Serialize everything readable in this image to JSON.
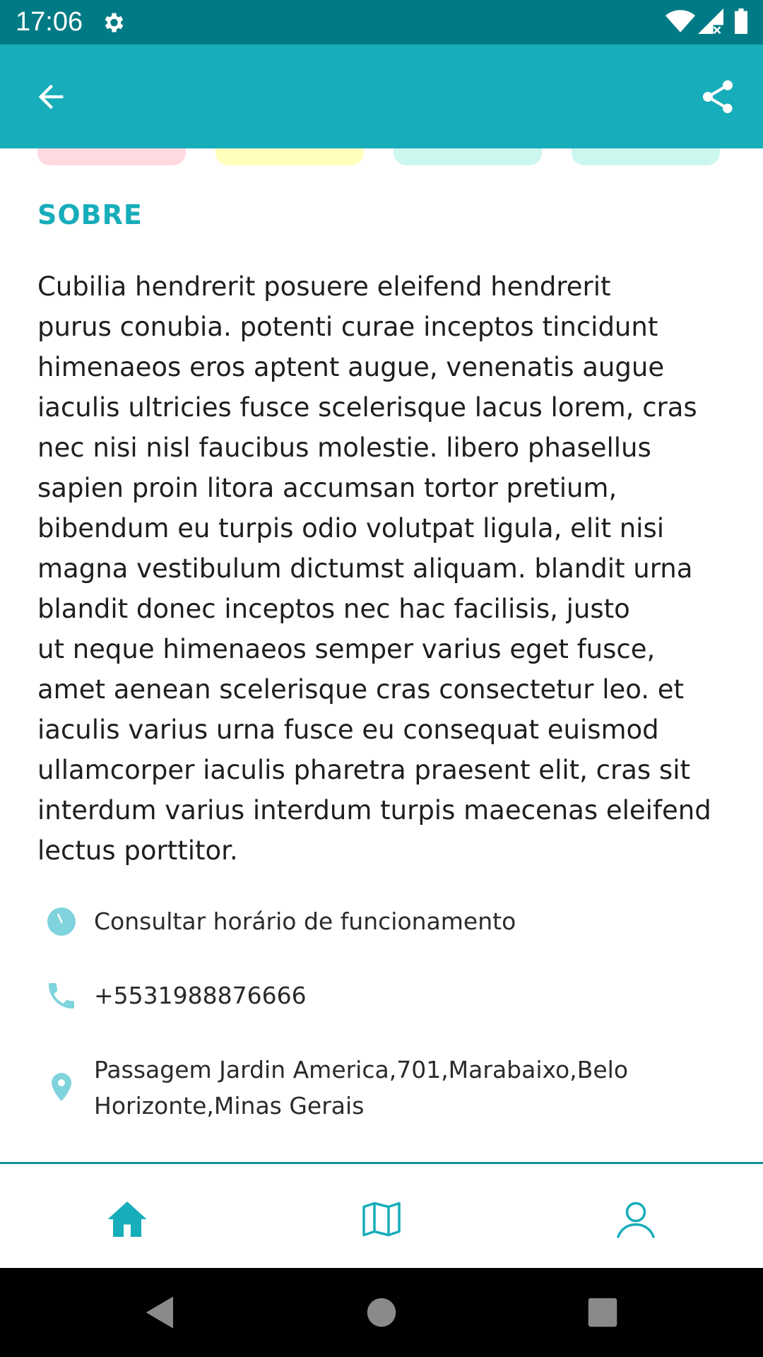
{
  "status_bar": {
    "time": "17:06",
    "left_icon": "gear-icon",
    "right_icons": [
      "wifi-icon",
      "signal-icon",
      "battery-icon"
    ],
    "background": "#007b85"
  },
  "app_bar": {
    "background": "#17adba",
    "back_icon": "arrow-back-icon",
    "share_icon": "share-icon"
  },
  "chips": {
    "colors": [
      "#ffd9e0",
      "#ffffbd",
      "#ccf7ef",
      "#ccf7ef"
    ]
  },
  "section": {
    "title": "SOBRE",
    "accent_color": "#17adba"
  },
  "about": {
    "lines": [
      "Cubilia hendrerit posuere eleifend hendrerit",
      "purus conubia. potenti curae inceptos tincidunt",
      "himenaeos eros aptent augue, venenatis augue",
      "iaculis ultricies fusce scelerisque lacus lorem, cras",
      "nec nisi nisl faucibus molestie. libero phasellus",
      "sapien proin litora accumsan tortor pretium,",
      "bibendum eu turpis odio volutpat ligula, elit nisi",
      "magna vestibulum dictumst aliquam. blandit urna",
      "blandit donec inceptos nec hac facilisis, justo",
      "ut neque himenaeos semper varius eget fusce,",
      "amet aenean scelerisque cras consectetur leo. et",
      "iaculis varius urna fusce eu consequat euismod",
      "ullamcorper iaculis pharetra praesent elit, cras sit",
      "interdum varius interdum turpis maecenas eleifend",
      "lectus porttitor."
    ]
  },
  "info": {
    "hours": {
      "icon": "clock-icon",
      "text": "Consultar horário de funcionamento"
    },
    "phone": {
      "icon": "phone-icon",
      "text": "+5531988876666"
    },
    "address": {
      "icon": "location-pin-icon",
      "line1": "Passagem Jardin America,701,Marabaixo,Belo",
      "line2": "Horizonte,Minas Gerais"
    },
    "icon_color": "#7fd3dc"
  },
  "bottom_nav": {
    "items": [
      "home-icon",
      "map-icon",
      "profile-icon"
    ],
    "active": "home-icon",
    "color": "#17adba"
  },
  "system_nav": {
    "items": [
      "back-triangle-icon",
      "home-circle-icon",
      "recents-square-icon"
    ]
  }
}
